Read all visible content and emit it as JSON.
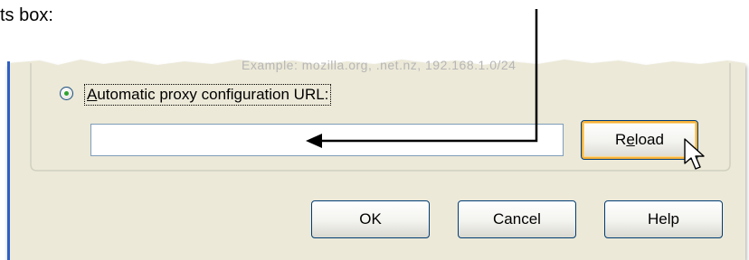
{
  "caption": {
    "text": "ts box:"
  },
  "dialog": {
    "example_text": "Example: mozilla.org, .net.nz, 192.168.1.0/24",
    "proxy_option": {
      "label_first": "A",
      "label_rest": "utomatic proxy configuration URL:",
      "selected": true
    },
    "url_input": {
      "value": "",
      "placeholder": ""
    },
    "reload_button": {
      "pre": "R",
      "accel": "e",
      "post": "load"
    },
    "ok_button": "OK",
    "cancel_button": "Cancel",
    "help_button": "Help"
  },
  "icons": {
    "annotation": "arrow-icon",
    "pointer": "mouse-cursor-icon"
  },
  "colors": {
    "dialog_accent_border": "#2f5fc6",
    "button_border": "#003c74",
    "focus_highlight": "#f8b23a",
    "radio_dot": "#2ea32e"
  }
}
